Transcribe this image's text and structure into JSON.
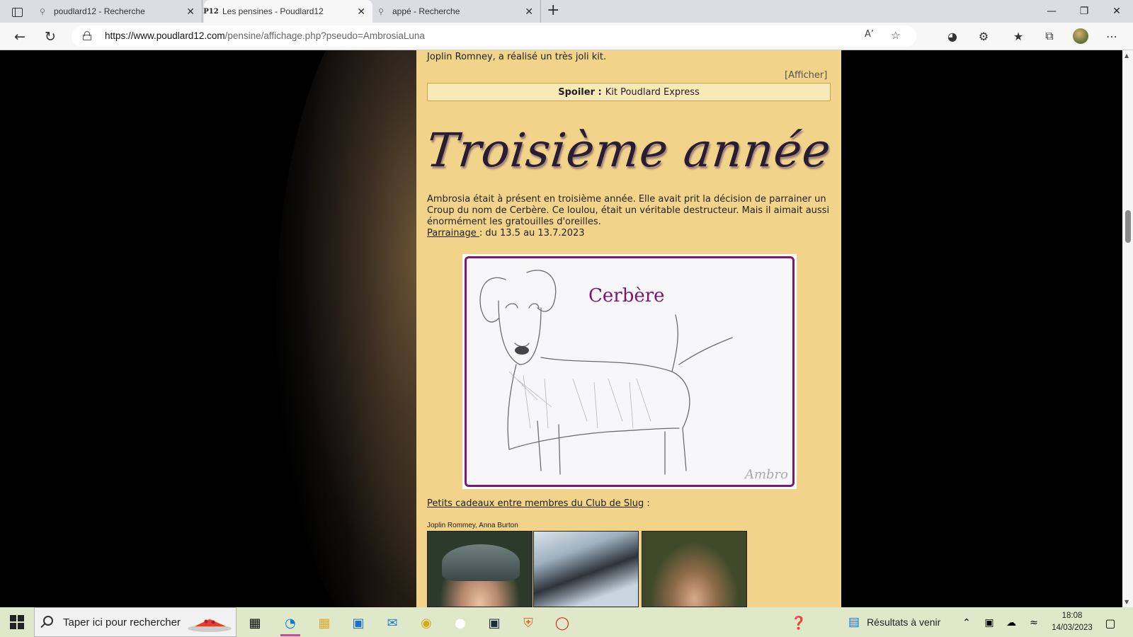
{
  "browser": {
    "tabs": [
      {
        "label": "poudlard12 - Recherche",
        "icon": "search-icon"
      },
      {
        "label": "Les pensines - Poudlard12",
        "icon": "P12",
        "active": true
      },
      {
        "label": "appé - Recherche",
        "icon": "search-icon"
      }
    ],
    "url_host": "https://www.poudlard12.com",
    "url_path": "/pensine/affichage.php?pseudo=AmbrosiaLuna"
  },
  "page": {
    "intro_text": "Joplin Romney, a réalisé un très joli kit.",
    "afficher_label": "[Afficher]",
    "spoiler_label": "Spoiler :",
    "spoiler_title": "Kit Poudlard Express",
    "heading": "Troisième année",
    "paragraph": "Ambrosia était à présent en troisième année. Elle avait prit la décision de parrainer un Croup du nom de Cerbère. Ce loulou, était un véritable destructeur. Mais il aimait aussi énormément les gratouilles d'oreilles.",
    "parrainage_label": "Parrainage ",
    "parrainage_dates": ": du 13.5 au 13.7.2023",
    "drawing_name": "Cerbère",
    "drawing_signature": "Ambro",
    "gifts_link": "Petits cadeaux entre membres du Club de Slug",
    "gifts_suffix": " :",
    "gifts_authors": "Joplin Rommey, Anna Burton"
  },
  "taskbar": {
    "search_placeholder": "Taper ici pour rechercher",
    "tray_text": "Résultats à venir",
    "time": "18:08",
    "date": "14/03/2023"
  },
  "colors": {
    "column_bg": "#f1d38a",
    "spoiler_bg": "#f8e9b8",
    "frame_accent": "#7a1a74",
    "taskbar_bg": "#dfe9c9"
  }
}
